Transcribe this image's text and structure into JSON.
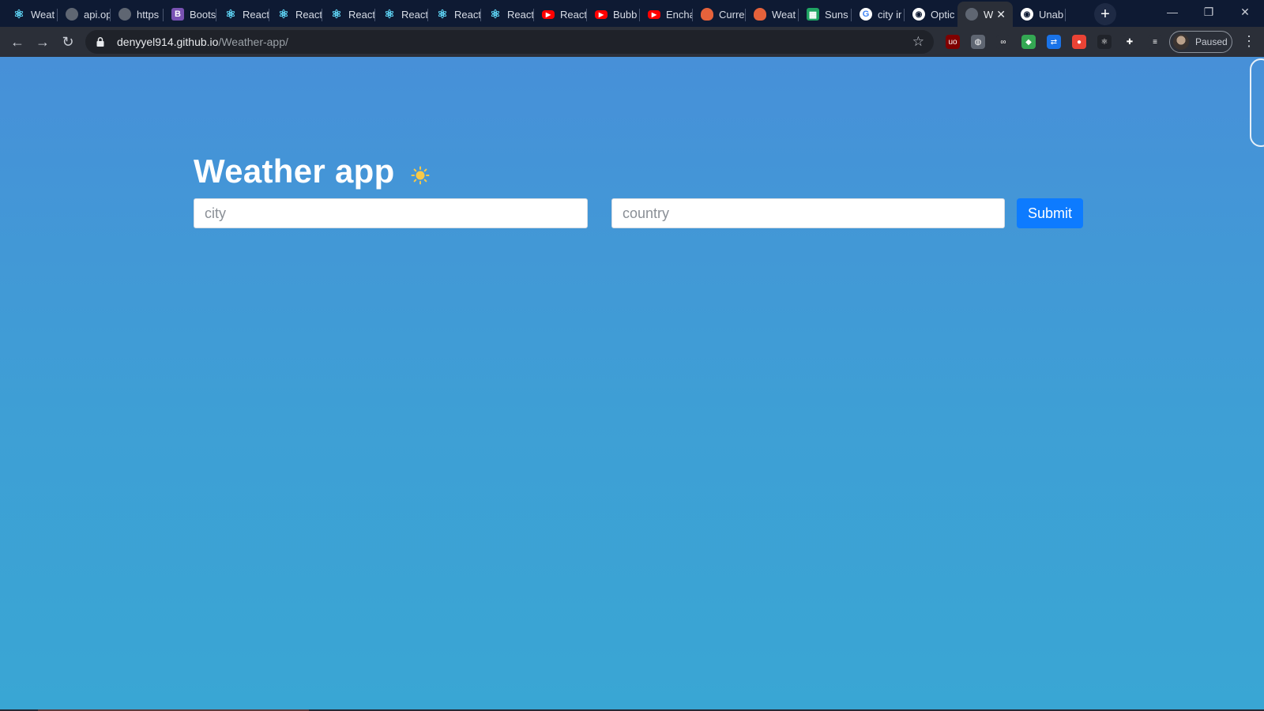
{
  "browser": {
    "tabs": [
      {
        "title": "Weat",
        "icon": "react-icon"
      },
      {
        "title": "api.op",
        "icon": "globe-icon"
      },
      {
        "title": "https",
        "icon": "globe-icon"
      },
      {
        "title": "Boots",
        "icon": "bootstrap-icon"
      },
      {
        "title": "React",
        "icon": "react-icon"
      },
      {
        "title": "React",
        "icon": "react-icon"
      },
      {
        "title": "React",
        "icon": "react-icon"
      },
      {
        "title": "React",
        "icon": "react-icon"
      },
      {
        "title": "React",
        "icon": "react-icon"
      },
      {
        "title": "React",
        "icon": "react-icon"
      },
      {
        "title": "React",
        "icon": "youtube-icon"
      },
      {
        "title": "Bubb",
        "icon": "youtube-icon"
      },
      {
        "title": "Encha",
        "icon": "youtube-icon"
      },
      {
        "title": "Curre",
        "icon": "owl-icon"
      },
      {
        "title": "Weat",
        "icon": "owl-icon"
      },
      {
        "title": "Suns",
        "icon": "sheets-icon"
      },
      {
        "title": "city ir",
        "icon": "google-icon"
      },
      {
        "title": "Optic",
        "icon": "github-icon"
      },
      {
        "title": "W",
        "icon": "globe-icon",
        "active": true
      },
      {
        "title": "Unab",
        "icon": "github-icon"
      }
    ],
    "bootstrap_glyph": "B",
    "github_glyph": "◉",
    "youtube_glyph": "▶",
    "google_glyph": "G",
    "sheets_glyph": "▦",
    "react_glyph": "⚛",
    "new_tab_glyph": "+",
    "close_glyph": "✕",
    "minimize_glyph": "—",
    "restore_glyph": "❐",
    "window_close_glyph": "✕",
    "back_glyph": "←",
    "forward_glyph": "→",
    "reload_glyph": "↻",
    "url_host": "denyyel914.github.io",
    "url_path": "/Weather-app/",
    "bookmark_glyph": "☆",
    "profile_status": "Paused",
    "menu_glyph": "⋮",
    "extensions": [
      {
        "name": "ublock-icon",
        "glyph": "uo",
        "color": "#800000"
      },
      {
        "name": "globe-extension-icon",
        "glyph": "◍",
        "color": "#5f6672"
      },
      {
        "name": "link-extension-icon",
        "glyph": "∞",
        "color": "#2b2f38"
      },
      {
        "name": "sync-extension-icon",
        "glyph": "◆",
        "color": "#34a853"
      },
      {
        "name": "translate-extension-icon",
        "glyph": "⇄",
        "color": "#1a73e8"
      },
      {
        "name": "record-extension-icon",
        "glyph": "●",
        "color": "#ea4335"
      },
      {
        "name": "react-devtools-icon",
        "glyph": "⚛",
        "color": "#20232a"
      },
      {
        "name": "puzzle-icon",
        "glyph": "✚",
        "color": "#2b2f38"
      },
      {
        "name": "media-control-icon",
        "glyph": "≡",
        "color": "#2b2f38"
      }
    ]
  },
  "app": {
    "title": "Weather app",
    "city_placeholder": "city",
    "country_placeholder": "country",
    "submit_label": "Submit"
  },
  "colors": {
    "background_top": "#4790d8",
    "background_bottom": "#39a6d4",
    "submit": "#0d7bff",
    "sun": "#f7c948"
  }
}
